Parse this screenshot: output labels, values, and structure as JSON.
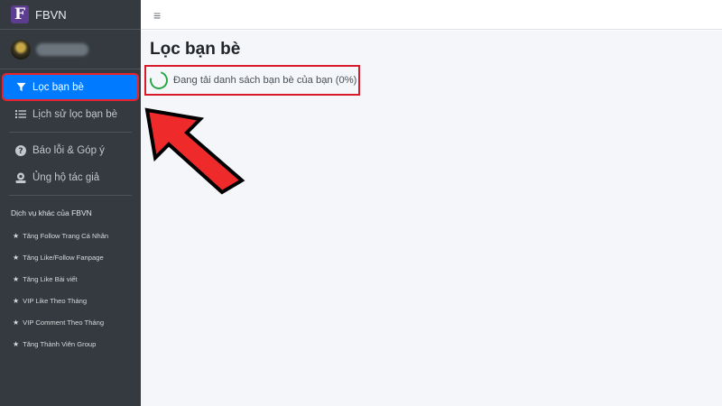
{
  "brand": {
    "logo_letter": "F",
    "name": "FBVN"
  },
  "nav": {
    "items": [
      {
        "label": "Lọc bạn bè",
        "icon": "filter-icon",
        "active": true
      },
      {
        "label": "Lịch sử lọc bạn bè",
        "icon": "list-icon",
        "active": false
      },
      {
        "label": "Báo lỗi & Góp ý",
        "icon": "question-circle-icon",
        "active": false
      },
      {
        "label": "Ủng hộ tác giả",
        "icon": "donate-icon",
        "active": false
      }
    ]
  },
  "services": {
    "header": "Dịch vụ khác của FBVN",
    "items": [
      "Tăng Follow Trang Cá Nhân",
      "Tăng Like/Follow Fanpage",
      "Tăng Like Bài viết",
      "VIP Like Theo Tháng",
      "VIP Comment Theo Tháng",
      "Tăng Thành Viên Group"
    ]
  },
  "main": {
    "title": "Lọc bạn bè",
    "loading_text": "Đang tải danh sách bạn bè của bạn (0%)",
    "progress_percent": 0
  },
  "colors": {
    "sidebar_bg": "#343a40",
    "active_bg": "#007bff",
    "highlight": "#e8232e",
    "spinner": "#28a745"
  }
}
